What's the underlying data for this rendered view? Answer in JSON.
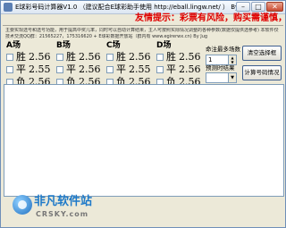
{
  "window": {
    "title": "E球彩号码计算器V1.0 （建议配合E球彩助手使用 http://eball.lingw.net/ ） By Jug",
    "min_glyph": "–",
    "max_glyph": "□",
    "close_glyph": "✕"
  },
  "notice": "友情提示：彩票有风险，购买需谨慎，量力而行，理性投注",
  "description": [
    "主要实现选号和选号功能，用于提高中奖几率，同时可以自动计算结果，主人可按照实际情况调整的各种参数(数据仅提供选参考) 本软件仅供娱乐：E球彩",
    "技术交流QQ群：21565227，175316620 + E球彩数据开放站（群内有 www.egirerwx.cn) By Jug"
  ],
  "fields": [
    {
      "header": "A场",
      "options": [
        {
          "name": "胜",
          "odds": "2.56"
        },
        {
          "name": "平",
          "odds": "2.55"
        },
        {
          "name": "负",
          "odds": "2.56"
        }
      ]
    },
    {
      "header": "B场",
      "options": [
        {
          "name": "胜",
          "odds": "2.56"
        },
        {
          "name": "平",
          "odds": "2.56"
        },
        {
          "name": "负",
          "odds": "2.56"
        }
      ]
    },
    {
      "header": "C场",
      "options": [
        {
          "name": "胜",
          "odds": "2.56"
        },
        {
          "name": "平",
          "odds": "2.55"
        },
        {
          "name": "负",
          "odds": "2.56"
        }
      ]
    },
    {
      "header": "D场",
      "options": [
        {
          "name": "胜",
          "odds": "2.56"
        },
        {
          "name": "平",
          "odds": "2.56"
        },
        {
          "name": "负",
          "odds": "2.56"
        }
      ]
    }
  ],
  "controls": {
    "min_hits_label": "命注最多场数",
    "min_hits_value": "1",
    "filter_label": "预测时结果",
    "filter_value": "",
    "clear_button": "清空选择框",
    "calc_button": "计算号码情况"
  },
  "watermark": {
    "title": "非凡软件站",
    "subtitle": "CRSKY.com"
  }
}
